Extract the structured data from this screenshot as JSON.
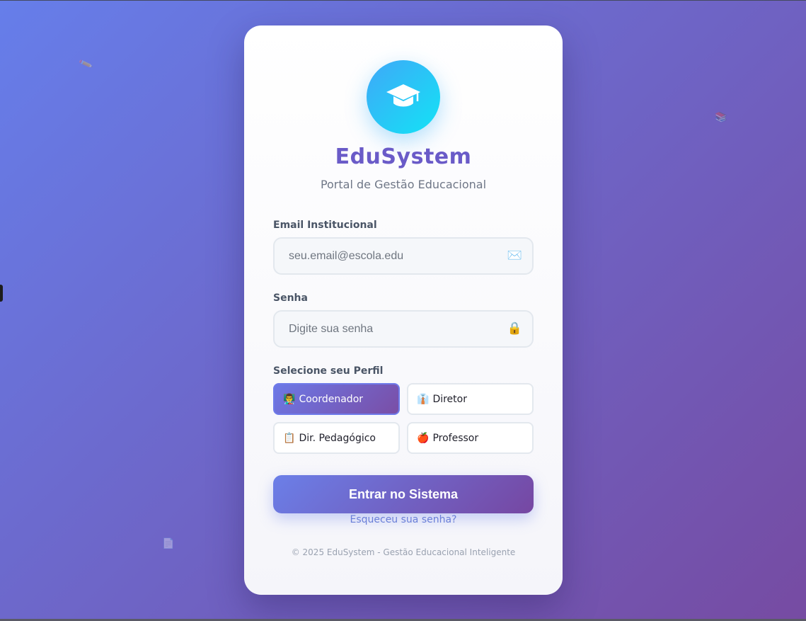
{
  "brand": {
    "name": "EduSystem",
    "tagline": "Portal de Gestão Educacional",
    "logo_icon": "graduation-cap-icon"
  },
  "form": {
    "email_label": "Email Institucional",
    "email_placeholder": "seu.email@escola.edu",
    "email_value": "",
    "email_icon": "✉️",
    "password_label": "Senha",
    "password_placeholder": "Digite sua senha",
    "password_value": "",
    "password_icon": "🔒",
    "role_label": "Selecione seu Perfil",
    "roles": [
      {
        "emoji": "👨‍🏫",
        "label": "Coordenador",
        "selected": true
      },
      {
        "emoji": "👔",
        "label": "Diretor",
        "selected": false
      },
      {
        "emoji": "📋",
        "label": "Dir. Pedagógico",
        "selected": false
      },
      {
        "emoji": "🍎",
        "label": "Professor",
        "selected": false
      }
    ],
    "submit_label": "Entrar no Sistema",
    "forgot_label": "Esqueceu sua senha?"
  },
  "footer": {
    "text": "© 2025 EduSystem - Gestão Educacional Inteligente"
  },
  "colors": {
    "bg_start": "#667eea",
    "bg_end": "#764ba2",
    "brand": "#6a5bc8",
    "logo_start": "#3fa8f8",
    "logo_end": "#13e3f5",
    "link": "#6a7fd8"
  },
  "decor": {
    "floating_icons": [
      "✏️",
      "📚",
      "📄"
    ]
  }
}
